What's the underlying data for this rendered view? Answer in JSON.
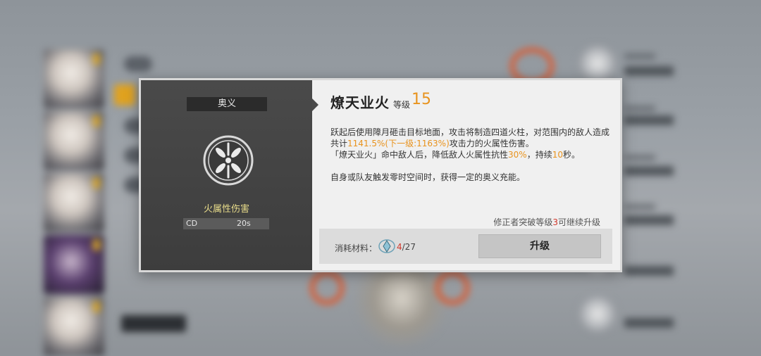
{
  "dialog": {
    "category_label": "奥义",
    "damage_type": "火属性伤害",
    "cd_label": "CD",
    "cd_value": "20s",
    "skill_name": "燎天业火",
    "level_label": "等级",
    "level_value": "15",
    "description": {
      "line1_a": "跃起后使用障月砸击目标地面，攻击将制造四道火柱，对范围内的敌人造成共计",
      "line1_hl": "1141.5%(下一级:1163%)",
      "line1_b": "攻击力的火属性伤害。",
      "line2_a": "「燎天业火」命中敌人后，降低敌人火属性抗性",
      "line2_hl1": "30%",
      "line2_b": "，持续",
      "line2_hl2": "10",
      "line2_c": "秒。",
      "line3": "自身或队友触发零时空间时，获得一定的奥义充能。"
    },
    "breakthrough_a": "修正者突破等级",
    "breakthrough_num": "3",
    "breakthrough_b": "可继续升级",
    "cost_label": "消耗材料：",
    "cost_have": "4",
    "cost_need": "/27",
    "upgrade_label": "升级"
  },
  "colors": {
    "accent_orange": "#e8931e",
    "warning_red": "#d0362a",
    "panel_dark": "#4a4a4a"
  }
}
